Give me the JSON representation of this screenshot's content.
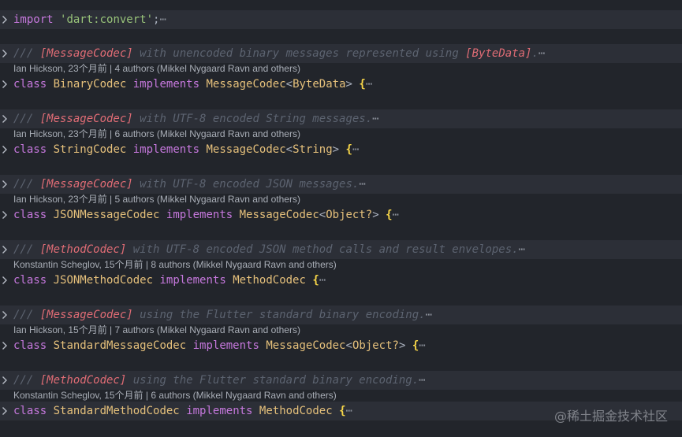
{
  "import_line": {
    "keyword": "import",
    "string": "'dart:convert'",
    "semicolon": ";",
    "ellipsis": "⋯"
  },
  "blocks": [
    {
      "comment_prefix": "/// ",
      "comment_ref": "[MessageCodec]",
      "comment_text": " with unencoded binary messages represented using ",
      "comment_ref2": "[ByteData]",
      "comment_tail": ".",
      "lens": "Ian Hickson, 23个月前 | 4 authors (Mikkel Nygaard Ravn and others)",
      "class_kw": "class",
      "class_name": "BinaryCodec",
      "implements_kw": "implements",
      "iface": "MessageCodec",
      "generic_open": "<",
      "generic_type": "ByteData",
      "generic_close": ">",
      "brace": "{"
    },
    {
      "comment_prefix": "/// ",
      "comment_ref": "[MessageCodec]",
      "comment_text": " with UTF-8 encoded String messages.",
      "comment_ref2": "",
      "comment_tail": "",
      "lens": "Ian Hickson, 23个月前 | 6 authors (Mikkel Nygaard Ravn and others)",
      "class_kw": "class",
      "class_name": "StringCodec",
      "implements_kw": "implements",
      "iface": "MessageCodec",
      "generic_open": "<",
      "generic_type": "String",
      "generic_close": ">",
      "brace": "{"
    },
    {
      "comment_prefix": "/// ",
      "comment_ref": "[MessageCodec]",
      "comment_text": " with UTF-8 encoded JSON messages.",
      "comment_ref2": "",
      "comment_tail": "",
      "lens": "Ian Hickson, 23个月前 | 5 authors (Mikkel Nygaard Ravn and others)",
      "class_kw": "class",
      "class_name": "JSONMessageCodec",
      "implements_kw": "implements",
      "iface": "MessageCodec",
      "generic_open": "<",
      "generic_type": "Object?",
      "generic_close": ">",
      "brace": "{"
    },
    {
      "comment_prefix": "/// ",
      "comment_ref": "[MethodCodec]",
      "comment_text": " with UTF-8 encoded JSON method calls and result envelopes.",
      "comment_ref2": "",
      "comment_tail": "",
      "lens": "Konstantin Scheglov, 15个月前 | 8 authors (Mikkel Nygaard Ravn and others)",
      "class_kw": "class",
      "class_name": "JSONMethodCodec",
      "implements_kw": "implements",
      "iface": "MethodCodec",
      "generic_open": "",
      "generic_type": "",
      "generic_close": "",
      "brace": "{"
    },
    {
      "comment_prefix": "/// ",
      "comment_ref": "[MessageCodec]",
      "comment_text": " using the Flutter standard binary encoding.",
      "comment_ref2": "",
      "comment_tail": "",
      "lens": "Ian Hickson, 15个月前 | 7 authors (Mikkel Nygaard Ravn and others)",
      "class_kw": "class",
      "class_name": "StandardMessageCodec",
      "implements_kw": "implements",
      "iface": "MessageCodec",
      "generic_open": "<",
      "generic_type": "Object?",
      "generic_close": ">",
      "brace": "{"
    },
    {
      "comment_prefix": "/// ",
      "comment_ref": "[MethodCodec]",
      "comment_text": " using the Flutter standard binary encoding.",
      "comment_ref2": "",
      "comment_tail": "",
      "lens": "Konstantin Scheglov, 15个月前 | 6 authors (Mikkel Nygaard Ravn and others)",
      "class_kw": "class",
      "class_name": "StandardMethodCodec",
      "implements_kw": "implements",
      "iface": "MethodCodec",
      "generic_open": "",
      "generic_type": "",
      "generic_close": "",
      "brace": "{"
    }
  ],
  "ellipsis": "⋯",
  "watermark": "@稀土掘金技术社区",
  "colors": {
    "background": "#22252b",
    "keyword": "#c678dd",
    "string": "#98c379",
    "class_name": "#e5c07b",
    "comment": "#5c6370",
    "comment_ref": "#e06c75",
    "brace": "#f9d849"
  },
  "icons": {
    "fold": "chevron-right-icon"
  }
}
